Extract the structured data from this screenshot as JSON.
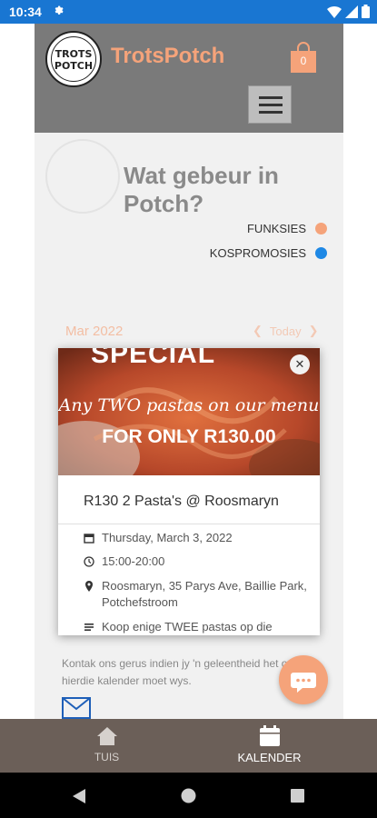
{
  "status_bar": {
    "time": "10:34"
  },
  "header": {
    "brand": "TrotsPotch",
    "logo_line1": "TROTS",
    "logo_line2": "POTCH",
    "cart_count": "0"
  },
  "page": {
    "title": "Wat gebeur in Potch?"
  },
  "legend": [
    {
      "label": "FUNKSIES",
      "color": "#f5a37a"
    },
    {
      "label": "KOSPROMOSIES",
      "color": "#1e88e5"
    }
  ],
  "calendar": {
    "month": "Mar 2022",
    "today_label": "Today"
  },
  "popup": {
    "promo_top": "SPECIAL",
    "promo_line1": "Any TWO pastas on our menu",
    "promo_line2": "FOR ONLY R130.00",
    "title": "R130 2 Pasta's @ Roosmaryn",
    "date": "Thursday, March 3, 2022",
    "time": "15:00-20:00",
    "location": "Roosmaryn, 35 Parys Ave, Baillie Park, Potchefstroom",
    "description": "Koop enige TWEE pastas op die"
  },
  "contact": {
    "text": "Kontak ons gerus indien jy 'n geleentheid het op hierdie kalender moet wys."
  },
  "bottom_nav": {
    "home_label": "TUIS",
    "calendar_label": "KALENDER"
  },
  "colors": {
    "accent": "#f5a37a",
    "header": "#7a7a7a",
    "status": "#1976d2",
    "nav": "#6b5f58"
  }
}
